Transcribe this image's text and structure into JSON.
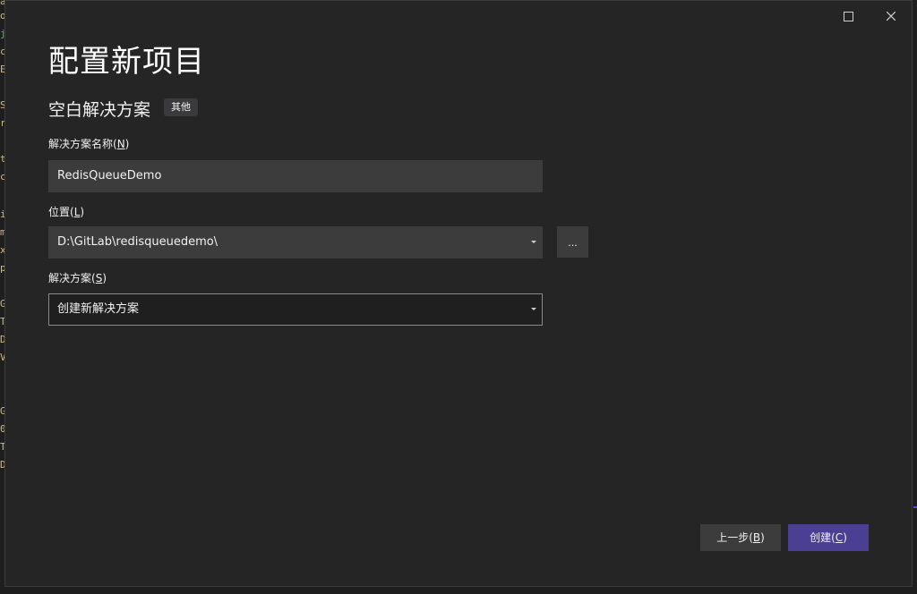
{
  "dialog": {
    "title": "配置新项目",
    "template_name": "空白解决方案",
    "template_tag": "其他"
  },
  "fields": {
    "solution_name": {
      "label_prefix": "解决方案名称(",
      "label_key": "N",
      "label_suffix": ")",
      "value": "RedisQueueDemo"
    },
    "location": {
      "label_prefix": "位置(",
      "label_key": "L",
      "label_suffix": ")",
      "value": "D:\\GitLab\\redisqueuedemo\\",
      "browse_label": "..."
    },
    "solution": {
      "label_prefix": "解决方案(",
      "label_key": "S",
      "label_suffix": ")",
      "value": "创建新解决方案"
    }
  },
  "buttons": {
    "prev": {
      "prefix": "上一步(",
      "key": "B",
      "suffix": ")"
    },
    "create": {
      "prefix": "创建(",
      "key": "C",
      "suffix": ")"
    }
  },
  "background_editor_chars": [
    "a",
    "o",
    "j",
    "c",
    "E",
    "S",
    "r",
    "t",
    "c",
    "i",
    "m",
    "x",
    "p",
    "G",
    "T",
    "D",
    "V",
    "G",
    "0",
    "T",
    "D"
  ],
  "colors": {
    "dialog_bg": "#252526",
    "input_bg": "#3c3c3c",
    "accent_button": "#4b3f94"
  }
}
